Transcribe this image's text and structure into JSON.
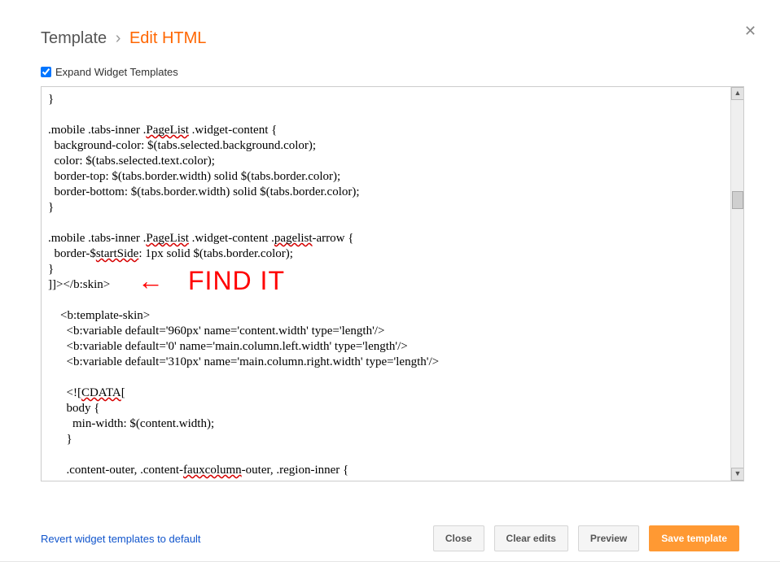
{
  "header": {
    "template_label": "Template",
    "separator": "›",
    "current_label": "Edit HTML"
  },
  "expand": {
    "label": "Expand Widget Templates",
    "checked": true
  },
  "annotation": {
    "arrow": "←",
    "text": "FIND IT"
  },
  "code_lines": [
    "}",
    "",
    ".mobile .tabs-inner .PageList .widget-content {",
    "  background-color: $(tabs.selected.background.color);",
    "  color: $(tabs.selected.text.color);",
    "  border-top: $(tabs.border.width) solid $(tabs.border.color);",
    "  border-bottom: $(tabs.border.width) solid $(tabs.border.color);",
    "}",
    "",
    ".mobile .tabs-inner .PageList .widget-content .pagelist-arrow {",
    "  border-$startSide: 1px solid $(tabs.border.color);",
    "}",
    "]]></b:skin>",
    "",
    "    <b:template-skin>",
    "      <b:variable default='960px' name='content.width' type='length'/>",
    "      <b:variable default='0' name='main.column.left.width' type='length'/>",
    "      <b:variable default='310px' name='main.column.right.width' type='length'/>",
    "",
    "      <![CDATA[",
    "      body {",
    "        min-width: $(content.width);",
    "      }",
    "",
    "      .content-outer, .content-fauxcolumn-outer, .region-inner {"
  ],
  "spell_tokens": [
    "PageList",
    "pagelist",
    "startSide",
    "CDATA",
    "fauxcolumn"
  ],
  "footer": {
    "revert_label": "Revert widget templates to default",
    "close_label": "Close",
    "clear_label": "Clear edits",
    "preview_label": "Preview",
    "save_label": "Save template"
  }
}
